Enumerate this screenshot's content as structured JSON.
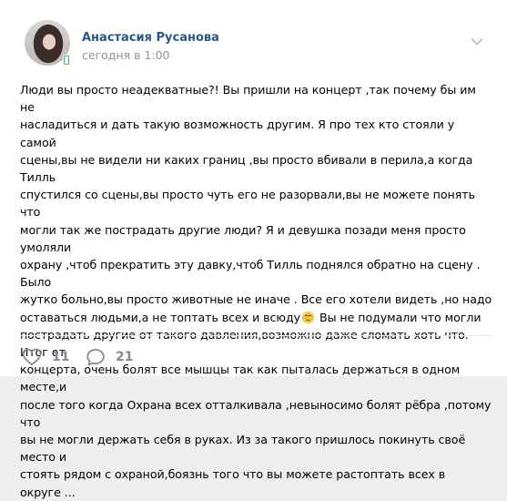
{
  "post": {
    "author": "Анастасия Русанова",
    "time": "сегодня в 1:00",
    "text_part1": "Люди вы просто неадекватные?! Вы пришли на концерт ,так почему бы им не\nнасладиться и дать такую возможность другим. Я про тех кто стояли у самой\nсцены,вы не видели ни каких границ ,вы просто вбивали в перила,а когда Тилль\nспустился со сцены,вы просто чуть его не разорвали,вы не можете понять что\nмогли так же пострадать другие люди? Я и девушка позади меня просто умоляли\nохрану ,чтоб прекратить эту давку,чтоб Тилль поднялся обратно на сцену . Было\nжутко больно,вы просто животные не иначе . Все его хотели видеть ,но надо\nоставаться людьми,а не топтать всех и всюду",
    "text_part2": " Вы не подумали что могли\nпострадать другие от такого давления,возможно даже сломать хоть что. Итог от\nконцерта, очень болят все мышцы так как пыталась держаться в одном месте,и\nпосле того когда Охрана всех отталкивала ,невыносимо болят рёбра ,потому что\nвы не могли держать себя в руках. Из за такого пришлось покинуть своё место и\nстоять рядом с охраной,боязнь того что вы можете растоптать всех в\nокруге ..."
  },
  "actions": {
    "likes": "11",
    "comments": "21"
  },
  "icons": {
    "menu": "chevron-down-icon",
    "like": "heart-icon",
    "comment": "comment-icon",
    "emoji": "unamused-face-emoji",
    "online": "mobile-online-icon"
  },
  "colors": {
    "author_link": "#2a5885",
    "muted": "#939393",
    "action": "#828a99"
  }
}
